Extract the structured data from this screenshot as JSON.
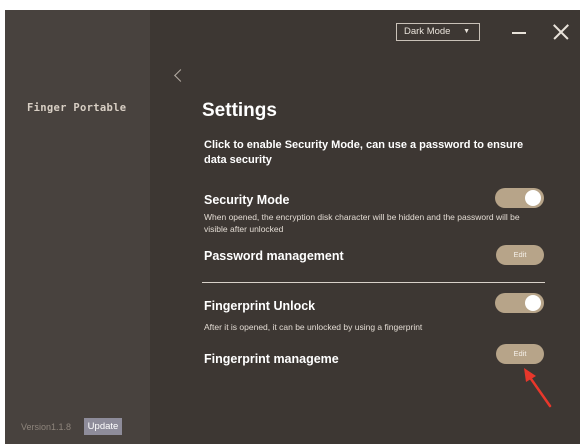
{
  "sidebar": {
    "app_name": "Finger Portable",
    "version": "Version1.1.8",
    "update_label": "Update"
  },
  "topbar": {
    "mode_select_value": "Dark Mode",
    "icons": [
      "chevron-down-icon",
      "minimize-icon",
      "close-icon",
      "back-chevron-icon"
    ]
  },
  "settings": {
    "title": "Settings",
    "description": "Click to enable  Security Mode, can use a password to ensure data security",
    "security_mode": {
      "title": "Security Mode",
      "subtitle": "When opened, the encryption disk character will be hidden and the password will be visible after unlocked",
      "enabled": true
    },
    "password_management": {
      "title": "Password management",
      "button_label": "Edit"
    },
    "fingerprint_unlock": {
      "title": "Fingerprint Unlock",
      "subtitle": "After it is opened, it can be unlocked by using a fingerprint",
      "enabled": true
    },
    "fingerprint_management": {
      "title": "Fingerprint manageme",
      "button_label": "Edit"
    }
  },
  "colors": {
    "sidebar_bg": "#48423e",
    "main_bg": "#3d3733",
    "accent": "#b7a489",
    "annotation_arrow": "#e8372b"
  }
}
